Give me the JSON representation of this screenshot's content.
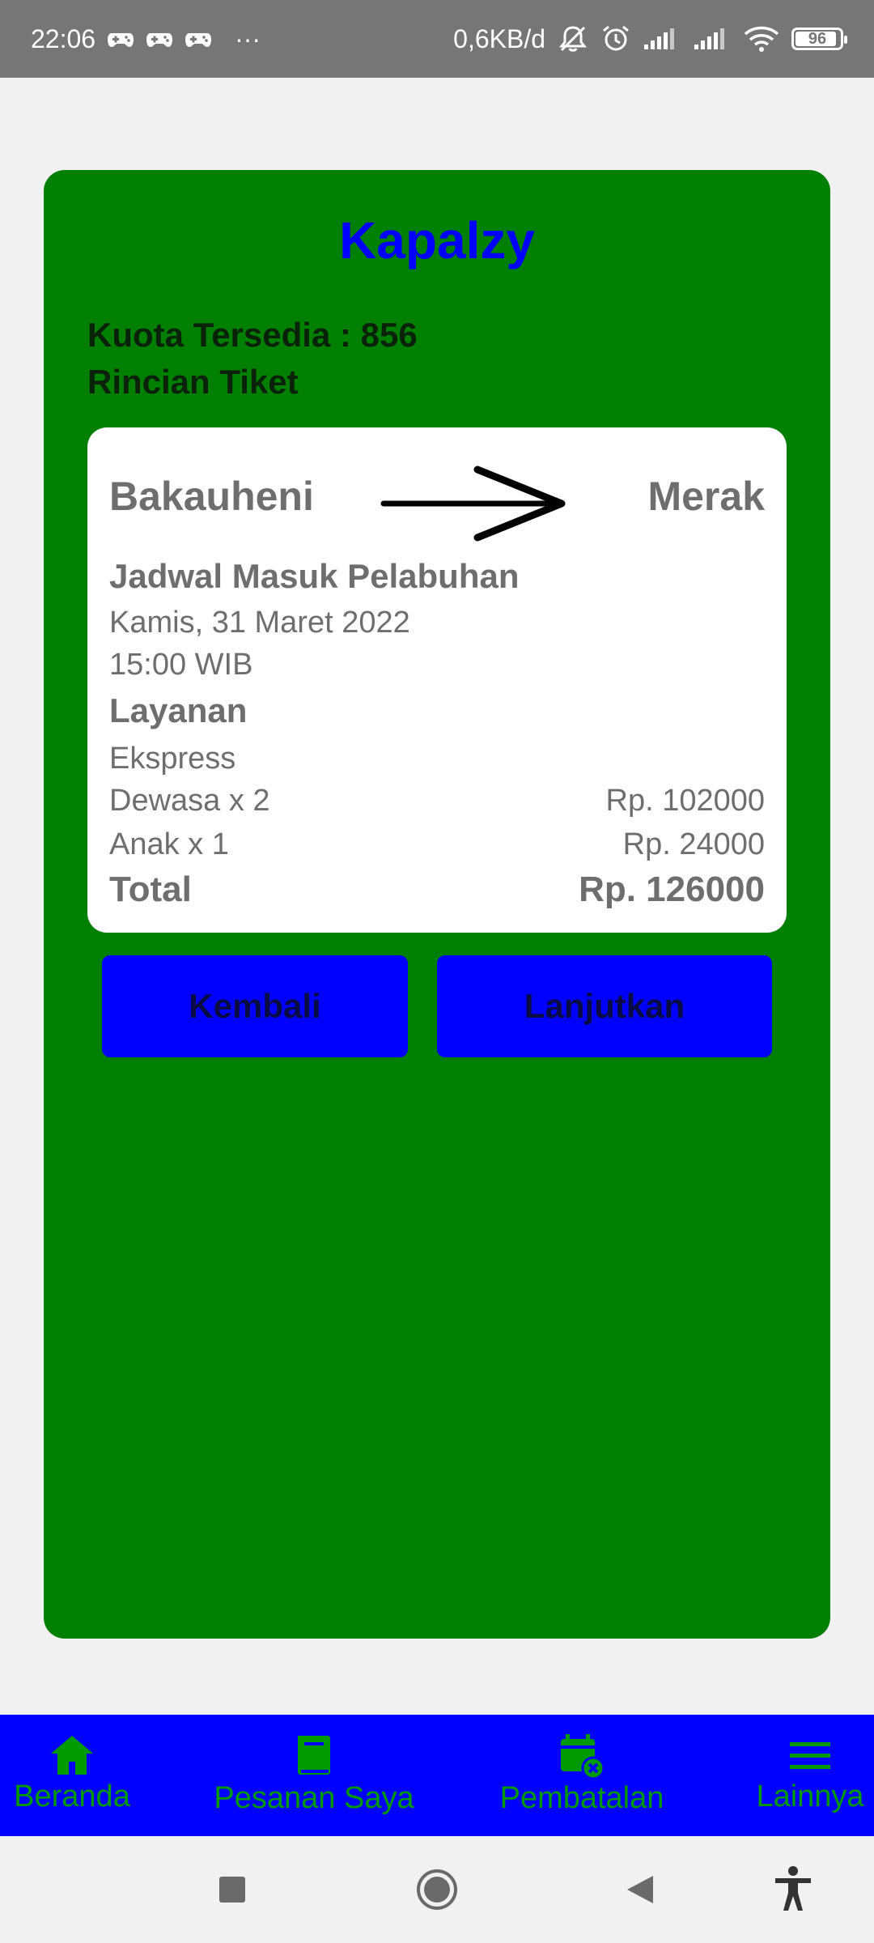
{
  "status_bar": {
    "time": "22:06",
    "more_indicator": "···",
    "network_speed": "0,6KB/d",
    "battery": "96",
    "battery_level": 0.96
  },
  "app": {
    "title": "Kapalzy",
    "quota": "Kuota Tersedia : 856",
    "details_heading": "Rincian Tiket"
  },
  "ticket": {
    "origin": "Bakauheni",
    "destination": "Merak",
    "schedule_title": "Jadwal Masuk Pelabuhan",
    "date": "Kamis, 31 Maret 2022",
    "time": "15:00 WIB",
    "service_title": "Layanan",
    "service_value": "Ekspress",
    "adult_label": "Dewasa x 2",
    "adult_price": "Rp. 102000",
    "child_label": "Anak x 1",
    "child_price": "Rp. 24000",
    "total_label": "Total",
    "total_price": "Rp. 126000"
  },
  "buttons": {
    "back": "Kembali",
    "next": "Lanjutkan"
  },
  "bottom_nav": {
    "items": [
      {
        "label": "Beranda",
        "icon": "home-icon"
      },
      {
        "label": "Pesanan Saya",
        "icon": "book-icon"
      },
      {
        "label": "Pembatalan",
        "icon": "calendar-cancel-icon"
      },
      {
        "label": "Lainnya",
        "icon": "menu-icon"
      }
    ]
  },
  "system_nav": {
    "icons": [
      "recents-icon",
      "home-circle-icon",
      "back-triangle-icon",
      "accessibility-icon"
    ]
  },
  "colors": {
    "card_green": "#007f00",
    "accent_blue": "#0000ff",
    "nav_icon_green": "#009a00",
    "status_bar_gray": "#767676"
  }
}
